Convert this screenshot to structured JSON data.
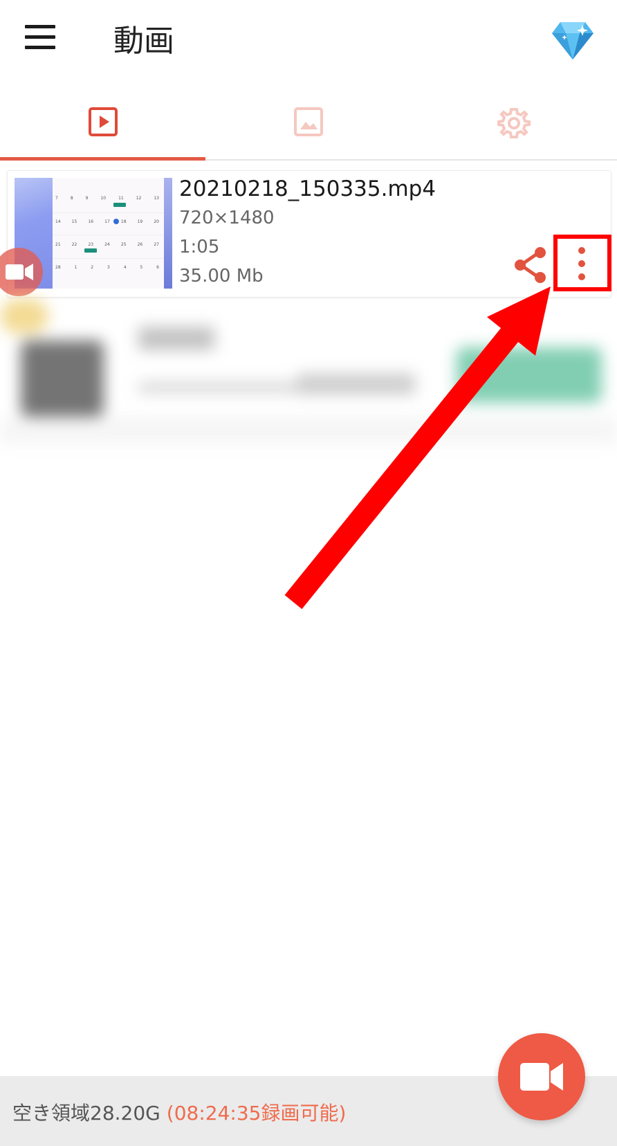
{
  "appbar": {
    "menu_icon": "hamburger-menu-icon",
    "title": "動画",
    "premium_icon": "diamond-icon"
  },
  "tabs": [
    {
      "name": "videos",
      "icon": "play-video-icon",
      "selected": true
    },
    {
      "name": "images",
      "icon": "image-icon",
      "selected": false
    },
    {
      "name": "settings",
      "icon": "gear-icon",
      "selected": false
    }
  ],
  "video": {
    "filename": "20210218_150335.mp4",
    "resolution": "720×1480",
    "duration": "1:05",
    "size": "35.00 Mb",
    "share_icon": "share-icon",
    "more_icon": "more-vertical-icon"
  },
  "thumbnail_calendar": {
    "rows": [
      [
        "7",
        "8",
        "9",
        "10",
        "11",
        "12",
        "13"
      ],
      [
        "14",
        "15",
        "16",
        "17",
        "18",
        "19",
        "20"
      ],
      [
        "21",
        "22",
        "23",
        "24",
        "25",
        "26",
        "27"
      ],
      [
        "28",
        "1",
        "2",
        "3",
        "4",
        "5",
        "6"
      ]
    ]
  },
  "status": {
    "free_space": "空き領域28.20G",
    "record_time": "(08:24:35録画可能)"
  },
  "colors": {
    "accent": "#ee5a45",
    "annotation": "#ff0000"
  },
  "fab": {
    "icon": "video-camera-icon"
  }
}
